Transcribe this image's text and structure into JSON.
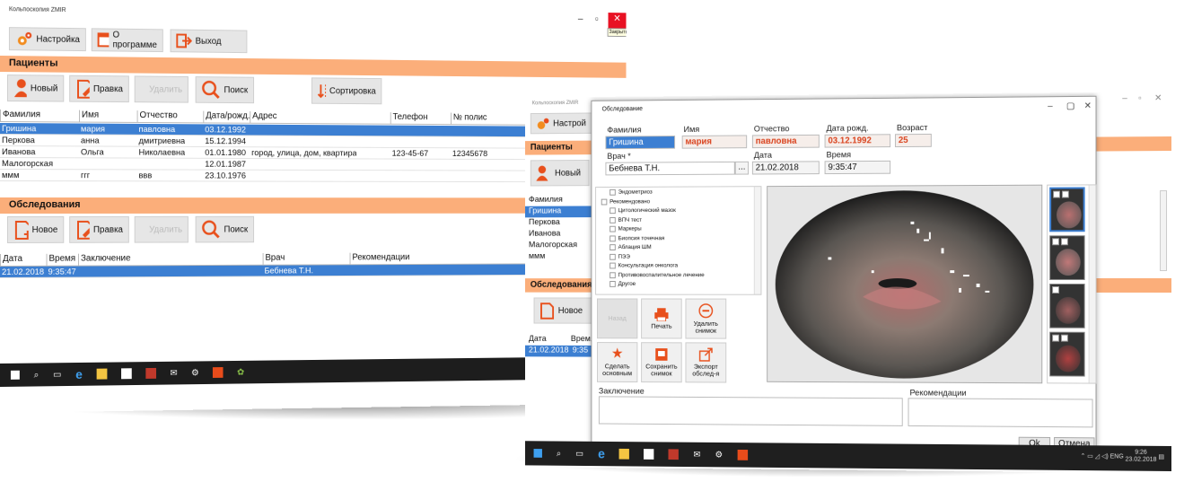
{
  "app_title": "Кольпоскопия ZMIR",
  "close_tooltip": "Закрыть",
  "toolbar": {
    "settings": "Настройка",
    "about": "О программе",
    "exit": "Выход"
  },
  "patients": {
    "section_title": "Пациенты",
    "buttons": {
      "new": "Новый",
      "edit": "Правка",
      "delete": "Удалить",
      "search": "Поиск",
      "sort": "Сортировка"
    },
    "columns": [
      "Фамилия",
      "Имя",
      "Отчество",
      "Дата/рожд.",
      "Адрес",
      "Телефон",
      "№ полис"
    ],
    "rows": [
      {
        "surname": "Гришина",
        "name": "мария",
        "patronymic": "павловна",
        "dob": "03.12.1992",
        "address": "",
        "phone": "",
        "policy": "",
        "selected": true
      },
      {
        "surname": "Перкова",
        "name": "анна",
        "patronymic": "дмитриевна",
        "dob": "15.12.1994",
        "address": "",
        "phone": "",
        "policy": "",
        "selected": false
      },
      {
        "surname": "Иванова",
        "name": "Ольга",
        "patronymic": "Николаевна",
        "dob": "01.01.1980",
        "address": "город, улица, дом, квартира",
        "phone": "123-45-67",
        "policy": "12345678",
        "selected": false
      },
      {
        "surname": "Малогорская",
        "name": "",
        "patronymic": "",
        "dob": "12.01.1987",
        "address": "",
        "phone": "",
        "policy": "",
        "selected": false
      },
      {
        "surname": "ммм",
        "name": "ггг",
        "patronymic": "ввв",
        "dob": "23.10.1976",
        "address": "",
        "phone": "",
        "policy": "",
        "selected": false
      }
    ]
  },
  "exams": {
    "section_title": "Обследования",
    "buttons": {
      "new": "Новое",
      "edit": "Правка",
      "delete": "Удалить",
      "search": "Поиск"
    },
    "columns": [
      "Дата",
      "Время",
      "Заключение",
      "Врач",
      "Рекомендации"
    ],
    "rows": [
      {
        "date": "21.02.2018",
        "time": "9:35:47",
        "conclusion": "",
        "doctor": "Бебнева Т.Н.",
        "recommendations": ""
      }
    ]
  },
  "background_window": {
    "settings": "Настрой",
    "patients_title": "Пациенты",
    "new": "Новый",
    "surname_col": "Фамилия",
    "surnames": [
      "Гришина",
      "Перкова",
      "Иванова",
      "Малогорская",
      "ммм"
    ],
    "exams_title": "Обследования",
    "exam_new": "Новое",
    "date_col": "Дата",
    "time_col": "Время",
    "exam_date": "21.02.2018",
    "exam_time": "9:35"
  },
  "dialog": {
    "title": "Обследование",
    "labels": {
      "surname": "Фамилия",
      "name": "Имя",
      "patronymic": "Отчество",
      "dob": "Дата рожд.",
      "age": "Возраст",
      "doctor": "Врач *",
      "date": "Дата",
      "time": "Время"
    },
    "values": {
      "surname": "Гришина",
      "name": "мария",
      "patronymic": "павловна",
      "dob": "03.12.1992",
      "age": "25",
      "doctor": "Бебнева Т.Н.",
      "date": "21.02.2018",
      "time": "9:35:47"
    },
    "doctor_browse": "...",
    "tree": [
      "Эндометриоз",
      "Рекомендовано",
      "Цитологический мазок",
      "ВПЧ тест",
      "Маркеры",
      "Биопсия точечная",
      "Аблация ШМ",
      "ПЭЭ",
      "Консультация онколога",
      "Противовоспалительное лечение",
      "Другое"
    ],
    "actions": {
      "back": "Назад",
      "print": "Печать",
      "delete_photo": "Удалить снимок",
      "make_main": "Сделать основным",
      "save_photo": "Сохранить снимок",
      "export": "Экспорт обслед-я"
    },
    "conclusion_label": "Заключение",
    "recommendations_label": "Рекомендации",
    "ok": "Ok",
    "cancel": "Отмена"
  },
  "tray": {
    "lang": "ENG",
    "time": "9:26",
    "date": "23.02.2018"
  },
  "colors": {
    "section": "#fbae7a",
    "selection": "#3c7fd2",
    "accent_red": "#d9431e"
  }
}
